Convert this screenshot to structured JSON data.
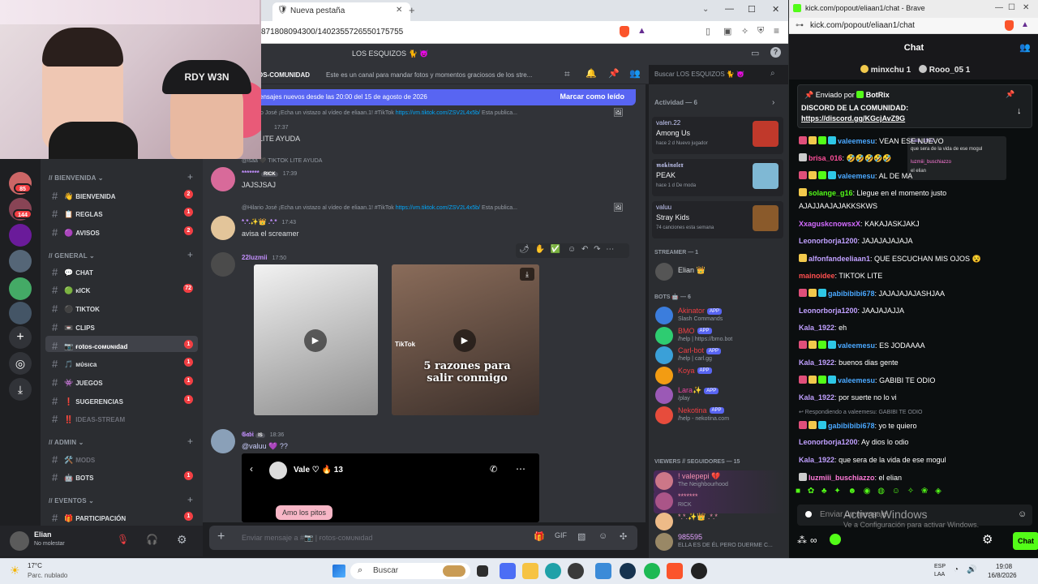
{
  "webcam": {
    "cap_text": "RDY W3N"
  },
  "discord_browser": {
    "tab_title": "Nueva pestaña",
    "url": "871808094300/1402355726550175755"
  },
  "discord": {
    "server_title": "LOS ESQUIZOS 🐈 😈",
    "channel_name": "OS-COMUNIDAD",
    "channel_topic": "Este es un canal para mandar fotos y momentos graciosos de los stre...",
    "search_placeholder": "Buscar LOS ESQUIZOS 🐈 😈",
    "new_messages_banner": "ensajes nuevos desde las 20:00 del 15 de agosto de 2026",
    "mark_read": "Marcar como leído",
    "server_badges": [
      "85",
      "144"
    ],
    "categories": [
      {
        "label": "// BIENVENIDA ⌄"
      },
      {
        "label": "// GENERAL ⌄"
      },
      {
        "label": "// ADMIN ⌄"
      },
      {
        "label": "// EVENTOS ⌄"
      }
    ],
    "channels": [
      {
        "emoji": "👋",
        "label": "BIENVENIDA",
        "badge": "2"
      },
      {
        "emoji": "📋",
        "label": "REGLAS",
        "badge": "1"
      },
      {
        "emoji": "🟣",
        "label": "AVISOS",
        "badge": "2"
      },
      {
        "emoji": "💬",
        "label": "CHAT",
        "badge": ""
      },
      {
        "emoji": "🟢",
        "label": "ĸICK",
        "badge": "72"
      },
      {
        "emoji": "⚫",
        "label": "TIKTOK",
        "badge": ""
      },
      {
        "emoji": "📼",
        "label": "CLIPS",
        "badge": ""
      },
      {
        "emoji": "📷",
        "label": "ғotos-coмυɴιdad",
        "badge": "1"
      },
      {
        "emoji": "🎵",
        "label": "мύѕιca",
        "badge": "1"
      },
      {
        "emoji": "👾",
        "label": "JUEGOS",
        "badge": "1"
      },
      {
        "emoji": "❗",
        "label": "SUGERENCIAS",
        "badge": "1"
      },
      {
        "emoji": "‼️",
        "label": "IDEAS-STREAM",
        "badge": ""
      },
      {
        "emoji": "🛠️",
        "label": "MODS",
        "badge": ""
      },
      {
        "emoji": "🤖",
        "label": "BOTS",
        "badge": "1"
      },
      {
        "emoji": "🎁",
        "label": "PARTICIPACIÓN",
        "badge": "1"
      }
    ],
    "user": {
      "name": "Elian",
      "status": "No molestar"
    },
    "messages": [
      {
        "reply": "@Hilario José ¡Echa un vistazo al vídeo de eliaan.1! #TikTok",
        "link": "https://vm.tiktok.com/ZSV2L4x5b/",
        "reply_tail": "Esta publica...",
        "time": "17:37",
        "text": "TOK LITE AYUDA"
      },
      {
        "reply": "@isaa 🖤 TIKTOK LITE AYUDA",
        "name": "*******",
        "tag": "RICK",
        "time": "17:39",
        "text": "JAJSJSAJ"
      },
      {
        "reply": "@Hilario José ¡Echa un vistazo al vídeo de eliaan.1! #TikTok",
        "link": "https://vm.tiktok.com/ZSV2L4x5b/",
        "reply_tail": "Esta publica...",
        "name": "*.*.✨👑 .*.*",
        "time": "17:43",
        "text": "avisa el screamer"
      },
      {
        "name": "22luzmii",
        "time": "17:50",
        "video_caption": "5 razones para salir conmigo",
        "tiktok_label": "TikTok"
      },
      {
        "name": "𝔊𝔞𝔟𝔦",
        "tag": "IS",
        "time": "18:36",
        "text": "@valuu 💜 ??",
        "embed_title": "Vale ♡ 🔥 13",
        "embed_text": "Amo los pitos"
      }
    ],
    "input_placeholder": "Enviar mensaje a #📷 | ғotos-coмυɴιdad",
    "members": {
      "activity_header": "Actividad — 6",
      "activities": [
        {
          "name": "valen.22",
          "game": "Among Us",
          "sub": "hace 2 d",
          "tag": "Nuevo jugador"
        },
        {
          "name": "𝖒𝖆𝖐𝖎𝖓𝖆𝖑𝖊𝖝",
          "game": "PEAK",
          "sub": "hace 1 d",
          "tag": "De moda"
        },
        {
          "name": "valuu",
          "game": "Stray Kids",
          "sub": "74 canciones esta semana",
          "tag": ""
        }
      ],
      "streamer_header": "STREAMER — 1",
      "streamer": "Elian 👑",
      "bots_header": "BOTS 🤖 — 6",
      "bots": [
        {
          "name": "Akinator",
          "sub": "Slash Commands",
          "color": "#f23f43"
        },
        {
          "name": "BMO",
          "sub": "/help | https://bmo.bot",
          "color": "#f23f43"
        },
        {
          "name": "Carl-bot",
          "sub": "/help | carl.gg",
          "color": "#f23f43"
        },
        {
          "name": "Koya",
          "sub": "",
          "color": "#f23f43"
        },
        {
          "name": "Lara✨",
          "sub": "/play",
          "color": "#eb459e"
        },
        {
          "name": "Nekotina",
          "sub": "/help - nekotina.com",
          "color": "#f23f43"
        }
      ],
      "viewers_header": "VIEWERS // SEGUIDORES — 15",
      "viewers": [
        {
          "name": "! valepepi 💔",
          "sub": "The Neighbourhood"
        },
        {
          "name": "*******",
          "sub": "RICK"
        },
        {
          "name": "*.*.✨👑 .*.*",
          "sub": ""
        },
        {
          "name": "985595",
          "sub": "ELLA ES DE ÉL PERO DUERME C..."
        }
      ],
      "app_label": "APP"
    }
  },
  "kick": {
    "window_title": "kick.com/popout/eliaan1/chat - Brave",
    "url": "kick.com/popout/eliaan1/chat",
    "header": "Chat",
    "gifters": [
      "minxchu 1",
      "Rooo_05 1"
    ],
    "pinned_by": "Enviado por",
    "pinned_user": "BotRix",
    "pinned_text": "DISCORD DE LA COMUNIDAD:",
    "pinned_link": "https://discord.gg/KGcjAvZ9G",
    "messages": [
      {
        "user": "valeemesu",
        "color": "#4aa8ff",
        "text": "VEAN ESE NUEVO",
        "badges": [
          "#e04f7a",
          "#f2c94c",
          "#53fc18",
          "#2ec7e6"
        ]
      },
      {
        "user": "brisa_016",
        "color": "#ff4f9a",
        "text": "🤣🤣🤣🤣🤣",
        "badges": [
          "#cccccc"
        ]
      },
      {
        "user": "valeemesu",
        "color": "#4aa8ff",
        "text": "AL DE MA",
        "badges": [
          "#e04f7a",
          "#f2c94c",
          "#53fc18",
          "#2ec7e6"
        ]
      },
      {
        "user": "solange_g16",
        "color": "#53fc18",
        "text": "Llegue en el momento justo",
        "badges": [
          "#f2c94c"
        ]
      },
      {
        "user": "",
        "color": "#ffffff",
        "text": "AJAJJAAJAJAKKSKWS",
        "badges": []
      },
      {
        "user": "XxaguskcnowsxX",
        "color": "#d36bff",
        "text": "KAKAJASKJAKJ",
        "badges": []
      },
      {
        "user": "Leonorborja1200",
        "color": "#c0a0ff",
        "text": "JAJAJAJAJAJA",
        "badges": []
      },
      {
        "user": "alfonfandeeliaan1",
        "color": "#c0a0ff",
        "text": "QUE ESCUCHAN MIS OJOS 😵",
        "badges": [
          "#f2c94c"
        ]
      },
      {
        "user": "mainoidee",
        "color": "#ff4f4f",
        "text": "TIKTOK LITE",
        "badges": []
      },
      {
        "user": "gabibibibi678",
        "color": "#4aa8ff",
        "text": "JAJAJAJAJASHJAA",
        "badges": [
          "#e04f7a",
          "#f2c94c",
          "#2ec7e6"
        ]
      },
      {
        "user": "Leonorborja1200",
        "color": "#c0a0ff",
        "text": "JAAJAJAJJA",
        "badges": []
      },
      {
        "user": "Kala_1922",
        "color": "#c0a0ff",
        "text": "eh",
        "badges": []
      },
      {
        "user": "valeemesu",
        "color": "#4aa8ff",
        "text": "ES JODAAAA",
        "badges": [
          "#e04f7a",
          "#f2c94c",
          "#53fc18",
          "#2ec7e6"
        ]
      },
      {
        "user": "Kala_1922",
        "color": "#c0a0ff",
        "text": "buenos dias gente",
        "badges": []
      },
      {
        "user": "valeemesu",
        "color": "#4aa8ff",
        "text": "GABIBI TE ODIO",
        "badges": [
          "#e04f7a",
          "#f2c94c",
          "#53fc18",
          "#2ec7e6"
        ]
      },
      {
        "user": "Kala_1922",
        "color": "#c0a0ff",
        "text": "por suerte no lo vi",
        "badges": []
      },
      {
        "reply": "↩ Respondiendo a valeemesu: GABIBI TE ODIO"
      },
      {
        "user": "gabibibibi678",
        "color": "#4aa8ff",
        "text": "yo te quiero",
        "badges": [
          "#e04f7a",
          "#f2c94c",
          "#2ec7e6"
        ]
      },
      {
        "user": "Leonorborja1200",
        "color": "#c0a0ff",
        "text": "Ay dios lo odio",
        "badges": []
      },
      {
        "user": "Kala_1922",
        "color": "#c0a0ff",
        "text": "que sera de la vida de ese mogul",
        "badges": []
      },
      {
        "user": "luzmiii_buschiazzo",
        "color": "#ff7ad9",
        "text": "el elian",
        "badges": [
          "#cccccc"
        ]
      }
    ],
    "tooltip_lines": [
      "Kala_1922",
      "que sera de la vida de ese mogul",
      "luzmiii_buschiazzo",
      "el elian"
    ],
    "input_placeholder": "Enviar un mensaje",
    "chat_button": "Chat",
    "watermark_title": "Activar Windows",
    "watermark_text": "Ve a Configuración para activar Windows."
  },
  "taskbar": {
    "weather_temp": "17°C",
    "weather_desc": "Parc. nublado",
    "search": "Buscar",
    "lang": "ESP",
    "lang2": "LAA",
    "time": "19:08",
    "date": "16/8/2026"
  }
}
